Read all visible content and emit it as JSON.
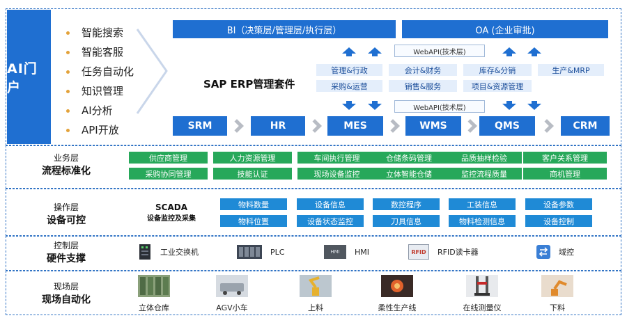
{
  "ai_portal": {
    "title": "AI门户",
    "items": [
      "智能搜索",
      "智能客服",
      "任务自动化",
      "知识管理",
      "AI分析",
      "API开放"
    ]
  },
  "top_bars": {
    "bi": "BI（决策层/管理层/执行层）",
    "oa": "OA (企业审批)"
  },
  "webapi": {
    "top": "WebAPI(技术层)",
    "bottom": "WebAPI(技术层)"
  },
  "erp": {
    "title": "SAP ERP管理套件",
    "modules": [
      "管理&行政",
      "会计&财务",
      "库存&分销",
      "生产&MRP",
      "采购&运营",
      "销售&服务",
      "项目&资源管理"
    ]
  },
  "systems": [
    "SRM",
    "HR",
    "MES",
    "WMS",
    "QMS",
    "CRM"
  ],
  "business_layer": {
    "label1": "业务层",
    "label2": "流程标准化",
    "items": [
      "供应商管理",
      "人力资源管理",
      "车间执行管理",
      "仓储条码管理",
      "品质抽样检验",
      "客户关系管理",
      "采购协同管理",
      "技能认证",
      "现场设备监控",
      "立体智能仓储",
      "监控流程质量",
      "商机管理"
    ]
  },
  "operation_layer": {
    "label1": "操作层",
    "label2": "设备可控",
    "scada1": "SCADA",
    "scada2": "设备监控及采集",
    "items": [
      "物料数量",
      "设备信息",
      "数控程序",
      "工装信息",
      "设备参数",
      "物料位置",
      "设备状态监控",
      "刀具信息",
      "物料检测信息",
      "设备控制"
    ]
  },
  "control_layer": {
    "label1": "控制层",
    "label2": "硬件支撑",
    "items": [
      "工业交换机",
      "PLC",
      "HMI",
      "RFID读卡器",
      "域控"
    ],
    "hmi_screen": "HMI",
    "rfid_badge": "RFID"
  },
  "field_layer": {
    "label1": "现场层",
    "label2": "现场自动化",
    "items": [
      "立体仓库",
      "AGV小车",
      "上料",
      "柔性生产线",
      "在线测量仪",
      "下料"
    ]
  },
  "colors": {
    "primary_blue": "#1f6fd1",
    "green": "#27a85a",
    "light_blue": "#1f8ad6",
    "module_bg": "#e4eefb"
  }
}
